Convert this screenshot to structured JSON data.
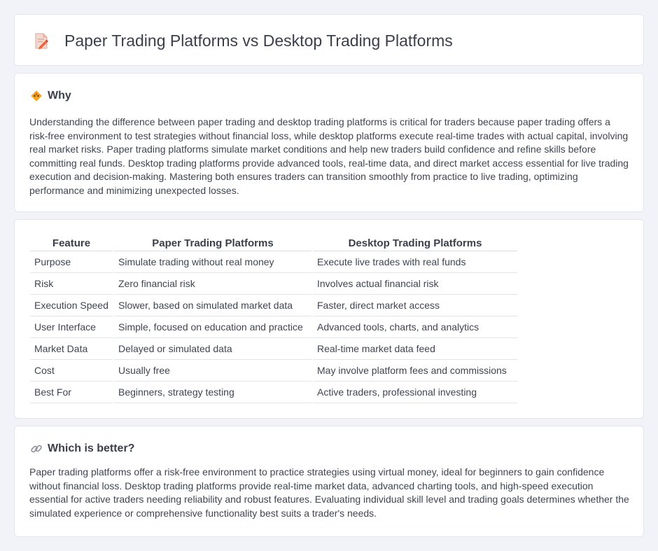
{
  "header": {
    "title": "Paper Trading Platforms vs Desktop Trading Platforms",
    "icon": "document-pencil-icon"
  },
  "why": {
    "heading": "Why",
    "icon": "diamond-icon",
    "text": "Understanding the difference between paper trading and desktop trading platforms is critical for traders because paper trading offers a risk-free environment to test strategies without financial loss, while desktop platforms execute real-time trades with actual capital, involving real market risks. Paper trading platforms simulate market conditions and help new traders build confidence and refine skills before committing real funds. Desktop trading platforms provide advanced tools, real-time data, and direct market access essential for live trading execution and decision-making. Mastering both ensures traders can transition smoothly from practice to live trading, optimizing performance and minimizing unexpected losses."
  },
  "comparison": {
    "headers": [
      "Feature",
      "Paper Trading Platforms",
      "Desktop Trading Platforms"
    ],
    "rows": [
      [
        "Purpose",
        "Simulate trading without real money",
        "Execute live trades with real funds"
      ],
      [
        "Risk",
        "Zero financial risk",
        "Involves actual financial risk"
      ],
      [
        "Execution Speed",
        "Slower, based on simulated market data",
        "Faster, direct market access"
      ],
      [
        "User Interface",
        "Simple, focused on education and practice",
        "Advanced tools, charts, and analytics"
      ],
      [
        "Market Data",
        "Delayed or simulated data",
        "Real-time market data feed"
      ],
      [
        "Cost",
        "Usually free",
        "May involve platform fees and commissions"
      ],
      [
        "Best For",
        "Beginners, strategy testing",
        "Active traders, professional investing"
      ]
    ]
  },
  "better": {
    "heading": "Which is better?",
    "icon": "link-icon",
    "text": "Paper trading platforms offer a risk-free environment to practice strategies using virtual money, ideal for beginners to gain confidence without financial loss. Desktop trading platforms provide real-time market data, advanced charting tools, and high-speed execution essential for active traders needing reliability and robust features. Evaluating individual skill level and trading goals determines whether the simulated experience or comprehensive functionality best suits a trader's needs."
  },
  "colors": {
    "background": "#f1f3f8",
    "card": "#ffffff",
    "accent_orange": "#f08a3c",
    "text": "#3a3f4a"
  }
}
